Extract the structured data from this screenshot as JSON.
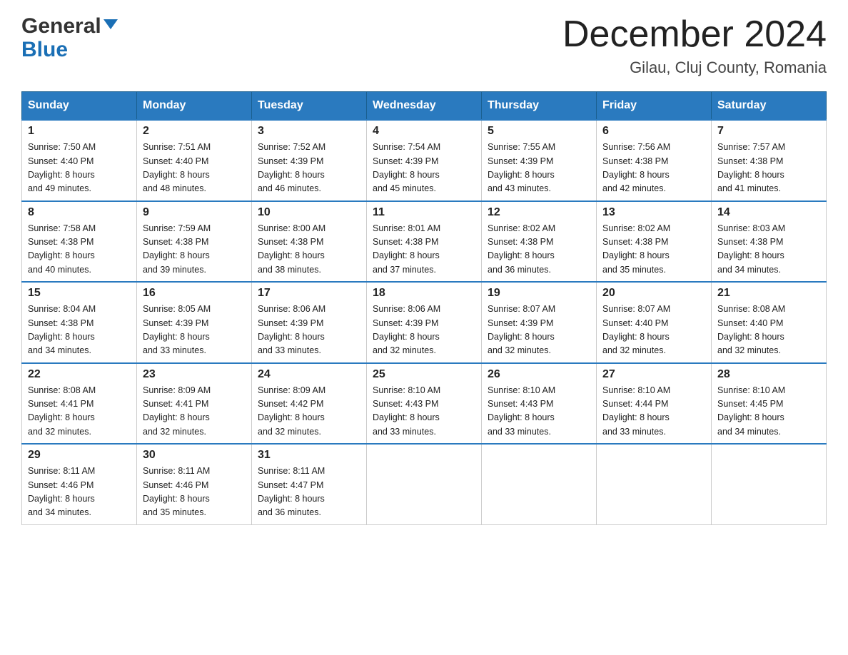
{
  "header": {
    "logo_general": "General",
    "logo_blue": "Blue",
    "month_title": "December 2024",
    "location": "Gilau, Cluj County, Romania"
  },
  "days_of_week": [
    "Sunday",
    "Monday",
    "Tuesday",
    "Wednesday",
    "Thursday",
    "Friday",
    "Saturday"
  ],
  "weeks": [
    [
      {
        "day": "1",
        "sunrise": "7:50 AM",
        "sunset": "4:40 PM",
        "daylight": "8 hours and 49 minutes."
      },
      {
        "day": "2",
        "sunrise": "7:51 AM",
        "sunset": "4:40 PM",
        "daylight": "8 hours and 48 minutes."
      },
      {
        "day": "3",
        "sunrise": "7:52 AM",
        "sunset": "4:39 PM",
        "daylight": "8 hours and 46 minutes."
      },
      {
        "day": "4",
        "sunrise": "7:54 AM",
        "sunset": "4:39 PM",
        "daylight": "8 hours and 45 minutes."
      },
      {
        "day": "5",
        "sunrise": "7:55 AM",
        "sunset": "4:39 PM",
        "daylight": "8 hours and 43 minutes."
      },
      {
        "day": "6",
        "sunrise": "7:56 AM",
        "sunset": "4:38 PM",
        "daylight": "8 hours and 42 minutes."
      },
      {
        "day": "7",
        "sunrise": "7:57 AM",
        "sunset": "4:38 PM",
        "daylight": "8 hours and 41 minutes."
      }
    ],
    [
      {
        "day": "8",
        "sunrise": "7:58 AM",
        "sunset": "4:38 PM",
        "daylight": "8 hours and 40 minutes."
      },
      {
        "day": "9",
        "sunrise": "7:59 AM",
        "sunset": "4:38 PM",
        "daylight": "8 hours and 39 minutes."
      },
      {
        "day": "10",
        "sunrise": "8:00 AM",
        "sunset": "4:38 PM",
        "daylight": "8 hours and 38 minutes."
      },
      {
        "day": "11",
        "sunrise": "8:01 AM",
        "sunset": "4:38 PM",
        "daylight": "8 hours and 37 minutes."
      },
      {
        "day": "12",
        "sunrise": "8:02 AM",
        "sunset": "4:38 PM",
        "daylight": "8 hours and 36 minutes."
      },
      {
        "day": "13",
        "sunrise": "8:02 AM",
        "sunset": "4:38 PM",
        "daylight": "8 hours and 35 minutes."
      },
      {
        "day": "14",
        "sunrise": "8:03 AM",
        "sunset": "4:38 PM",
        "daylight": "8 hours and 34 minutes."
      }
    ],
    [
      {
        "day": "15",
        "sunrise": "8:04 AM",
        "sunset": "4:38 PM",
        "daylight": "8 hours and 34 minutes."
      },
      {
        "day": "16",
        "sunrise": "8:05 AM",
        "sunset": "4:39 PM",
        "daylight": "8 hours and 33 minutes."
      },
      {
        "day": "17",
        "sunrise": "8:06 AM",
        "sunset": "4:39 PM",
        "daylight": "8 hours and 33 minutes."
      },
      {
        "day": "18",
        "sunrise": "8:06 AM",
        "sunset": "4:39 PM",
        "daylight": "8 hours and 32 minutes."
      },
      {
        "day": "19",
        "sunrise": "8:07 AM",
        "sunset": "4:39 PM",
        "daylight": "8 hours and 32 minutes."
      },
      {
        "day": "20",
        "sunrise": "8:07 AM",
        "sunset": "4:40 PM",
        "daylight": "8 hours and 32 minutes."
      },
      {
        "day": "21",
        "sunrise": "8:08 AM",
        "sunset": "4:40 PM",
        "daylight": "8 hours and 32 minutes."
      }
    ],
    [
      {
        "day": "22",
        "sunrise": "8:08 AM",
        "sunset": "4:41 PM",
        "daylight": "8 hours and 32 minutes."
      },
      {
        "day": "23",
        "sunrise": "8:09 AM",
        "sunset": "4:41 PM",
        "daylight": "8 hours and 32 minutes."
      },
      {
        "day": "24",
        "sunrise": "8:09 AM",
        "sunset": "4:42 PM",
        "daylight": "8 hours and 32 minutes."
      },
      {
        "day": "25",
        "sunrise": "8:10 AM",
        "sunset": "4:43 PM",
        "daylight": "8 hours and 33 minutes."
      },
      {
        "day": "26",
        "sunrise": "8:10 AM",
        "sunset": "4:43 PM",
        "daylight": "8 hours and 33 minutes."
      },
      {
        "day": "27",
        "sunrise": "8:10 AM",
        "sunset": "4:44 PM",
        "daylight": "8 hours and 33 minutes."
      },
      {
        "day": "28",
        "sunrise": "8:10 AM",
        "sunset": "4:45 PM",
        "daylight": "8 hours and 34 minutes."
      }
    ],
    [
      {
        "day": "29",
        "sunrise": "8:11 AM",
        "sunset": "4:46 PM",
        "daylight": "8 hours and 34 minutes."
      },
      {
        "day": "30",
        "sunrise": "8:11 AM",
        "sunset": "4:46 PM",
        "daylight": "8 hours and 35 minutes."
      },
      {
        "day": "31",
        "sunrise": "8:11 AM",
        "sunset": "4:47 PM",
        "daylight": "8 hours and 36 minutes."
      },
      null,
      null,
      null,
      null
    ]
  ],
  "labels": {
    "sunrise_prefix": "Sunrise: ",
    "sunset_prefix": "Sunset: ",
    "daylight_prefix": "Daylight: "
  }
}
